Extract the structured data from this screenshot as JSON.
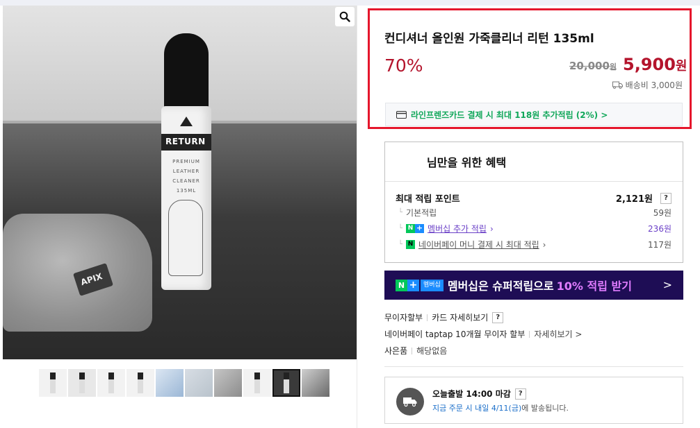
{
  "product": {
    "title": "컨디셔너 올인원 가죽클리너 리턴 135ml",
    "discount": "70%",
    "original_price": "20,000",
    "original_unit": "원",
    "sale_price": "5,900",
    "sale_unit": "원",
    "shipping": "배송비 3,000원",
    "card_promo": "라인프렌즈카드 결제 시 최대 118원 추가적립 (2%) >"
  },
  "image": {
    "bottle_label": "RETURN",
    "bottle_text": "PREMIUM LEATHER CLEANER",
    "bottle_volume": "135ML",
    "towel_label": "APIX",
    "thumbnail_count": 10,
    "selected_thumbnail": 9
  },
  "benefit": {
    "title": "님만을 위한 혜택",
    "max_points_label": "최대 적립 포인트",
    "max_points_value": "2,121원",
    "help": "?",
    "rows": [
      {
        "label": "기본적립",
        "value": "59원"
      },
      {
        "label": "멤버십 추가 적립",
        "value": "236원"
      },
      {
        "label": "네이버페이 머니 결제 시 최대 적립",
        "value": "117원"
      }
    ],
    "np_n": "N",
    "np_plus": "+",
    "pay_badge": "N"
  },
  "banner": {
    "badge_n": "N",
    "badge_plus": "+",
    "badge_text": "멤버십",
    "message": "멤버십은 슈퍼적립으로",
    "highlight": "10% 적립 받기",
    "arrow": ">"
  },
  "installment": {
    "label": "무이자할부",
    "card_detail": "카드 자세히보기",
    "help": "?",
    "naverpay": "네이버페이 taptap 10개월 무이자 할부",
    "detail": "자세히보기 >",
    "gift_label": "사은품",
    "gift_value": "해당없음"
  },
  "delivery": {
    "title": "오늘출발 14:00 마감",
    "help": "?",
    "sub_prefix": "지금 주문 시 내일 4/11(금)",
    "sub_suffix": "에 발송됩니다."
  },
  "colors": {
    "accent_red": "#b4142c",
    "highlight_border": "#e5162c",
    "naver_green": "#03c75a",
    "banner_bg": "#1e0d55"
  }
}
